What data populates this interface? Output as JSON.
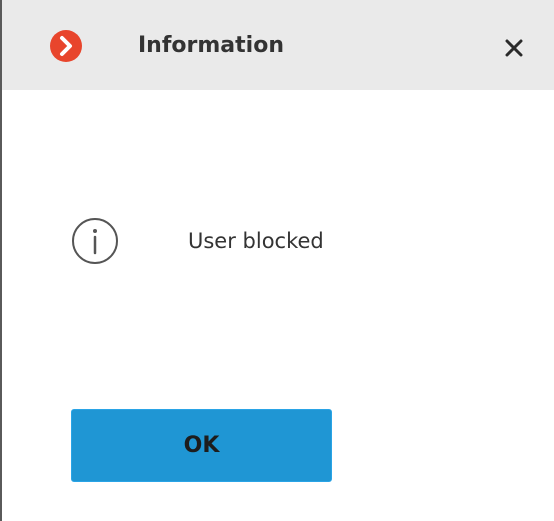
{
  "dialog": {
    "title": "Information",
    "close_icon": "close-icon",
    "app_icon": "chevron-right-circle-icon",
    "accent_color": "#e8452c",
    "message": "User blocked",
    "message_icon": "info-icon",
    "ok_label": "OK",
    "button_color": "#1f96d4"
  }
}
